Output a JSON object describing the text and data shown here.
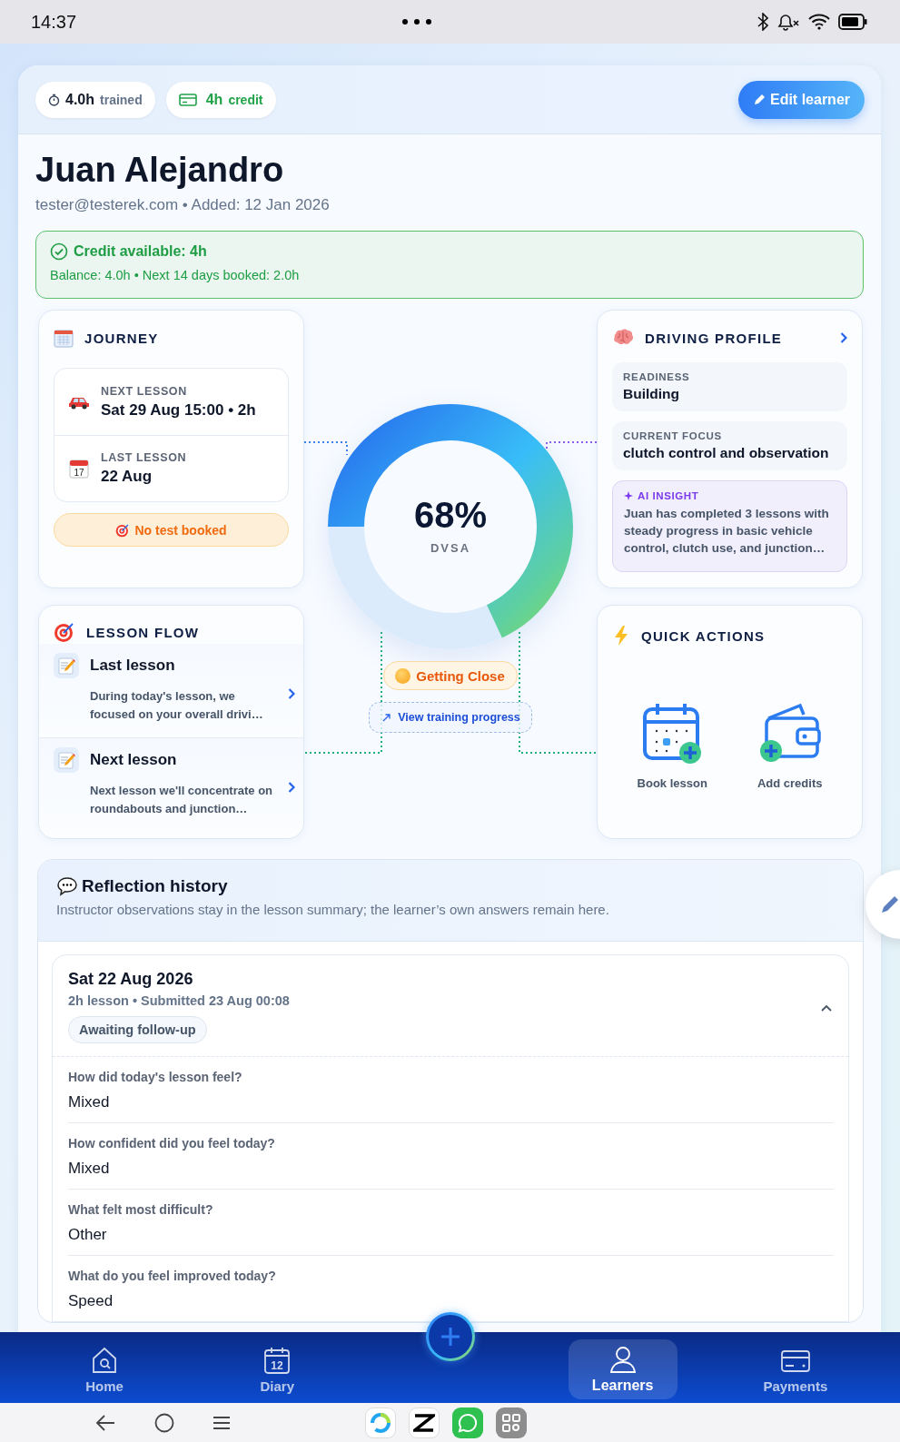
{
  "status_bar": {
    "time": "14:37"
  },
  "header": {
    "chips": [
      {
        "kind": "trained",
        "value": "4.0h",
        "label": "trained"
      },
      {
        "kind": "credit",
        "value": "4h",
        "label": "credit"
      }
    ],
    "edit_button": "Edit learner"
  },
  "learner": {
    "name": "Juan Alejandro",
    "subtitle": "tester@testerek.com • Added: 12 Jan 2026"
  },
  "credit_notice": {
    "title": "Credit available: 4h",
    "detail": "Balance: 4.0h • Next 14 days booked: 2.0h"
  },
  "journey": {
    "title": "JOURNEY",
    "items": [
      {
        "kind": "next",
        "label": "NEXT LESSON",
        "value": "Sat 29 Aug 15:00 • 2h"
      },
      {
        "kind": "last",
        "label": "LAST LESSON",
        "value": "22 Aug",
        "icon_text": "17"
      }
    ],
    "test_status": "No test booked"
  },
  "lesson_flow": {
    "title": "LESSON FLOW",
    "items": [
      {
        "title": "Last lesson",
        "summary": "During today's lesson, we focused on your overall drivi…"
      },
      {
        "title": "Next lesson",
        "summary": "Next lesson we'll concentrate on roundabouts and junction…"
      }
    ]
  },
  "progress": {
    "percent": "68%",
    "label": "DVSA",
    "level": 0.68,
    "status": "Getting Close",
    "link": "View training progress"
  },
  "driving_profile": {
    "title": "DRIVING PROFILE",
    "fields": [
      {
        "label": "READINESS",
        "value": "Building"
      },
      {
        "label": "CURRENT FOCUS",
        "value": "clutch control and observation"
      }
    ],
    "insight": {
      "label": "AI INSIGHT",
      "text": "Juan has completed 3 lessons with steady progress in basic vehicle control, clutch use, and junction…"
    }
  },
  "quick_actions": {
    "title": "QUICK ACTIONS",
    "actions": [
      {
        "kind": "book",
        "label": "Book lesson"
      },
      {
        "kind": "credits",
        "label": "Add credits"
      }
    ]
  },
  "reflection_history": {
    "title": "Reflection history",
    "subtitle": "Instructor observations stay in the lesson summary; the learner’s own answers remain here.",
    "entries": [
      {
        "date": "Sat 22 Aug 2026",
        "meta": "2h lesson • Submitted 23 Aug 00:08",
        "badge": "Awaiting follow-up",
        "expanded": true,
        "answers": [
          {
            "question": "How did today's lesson feel?",
            "answer": "Mixed"
          },
          {
            "question": "How confident did you feel today?",
            "answer": "Mixed"
          },
          {
            "question": "What felt most difficult?",
            "answer": "Other"
          },
          {
            "question": "What do you feel improved today?",
            "answer": "Speed"
          }
        ]
      }
    ]
  },
  "bottom_nav": {
    "items": [
      {
        "kind": "home",
        "label": "Home",
        "selected": false
      },
      {
        "kind": "diary",
        "label": "Diary",
        "selected": false,
        "icon_text": "12"
      },
      {
        "kind": "learners",
        "label": "Learners",
        "selected": true
      },
      {
        "kind": "payments",
        "label": "Payments",
        "selected": false
      }
    ]
  }
}
